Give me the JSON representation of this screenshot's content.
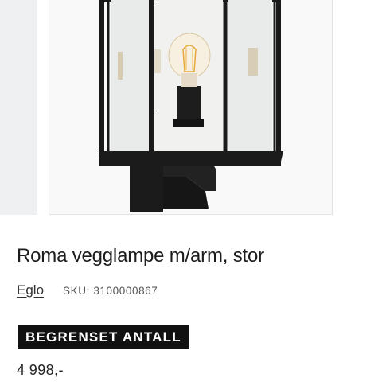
{
  "gallery": {
    "image_alt": "Roma vegglampe m/arm, stor",
    "zoom_icon": "magnifier-icon"
  },
  "product": {
    "title": "Roma vegglampe m/arm, stor",
    "brand": "Eglo",
    "sku_label": "SKU:",
    "sku": "3100000867",
    "badge": "BEGRENSET ANTALL",
    "price": "4 998,-"
  },
  "colors": {
    "badge_bg": "#111111",
    "badge_text": "#ffffff",
    "lamp_frame": "#1a1a1a"
  }
}
